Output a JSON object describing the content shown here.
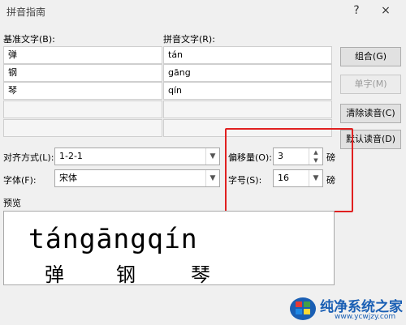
{
  "window": {
    "title": "拼音指南",
    "help": "?",
    "close": "×"
  },
  "columns": {
    "base": "基准文字(B):",
    "ruby": "拼音文字(R):"
  },
  "rows": [
    {
      "base": "弹",
      "ruby": "tán"
    },
    {
      "base": "钢",
      "ruby": "gāng"
    },
    {
      "base": "琴",
      "ruby": "qín"
    },
    {
      "base": "",
      "ruby": ""
    },
    {
      "base": "",
      "ruby": ""
    }
  ],
  "buttons": {
    "group": "组合(G)",
    "mono": "单字(M)",
    "clear": "清除读音(C)",
    "default": "默认读音(D)"
  },
  "options": {
    "alignment_label": "对齐方式(L):",
    "alignment_value": "1-2-1",
    "font_label": "字体(F):",
    "font_value": "宋体",
    "offset_label": "偏移量(O):",
    "offset_value": "3",
    "offset_unit": "磅",
    "size_label": "字号(S):",
    "size_value": "16",
    "size_unit": "磅"
  },
  "preview": {
    "label": "预览",
    "ruby": "tángāngqín",
    "chars": [
      "弹",
      "钢",
      "琴"
    ]
  },
  "watermark": {
    "name": "纯净系统之家",
    "url": "www.ycwjzy.com"
  },
  "colors": {
    "highlight": "#e02020",
    "window_bg": "#f0f0f0",
    "watermark_blue": "#1a5fb4"
  }
}
